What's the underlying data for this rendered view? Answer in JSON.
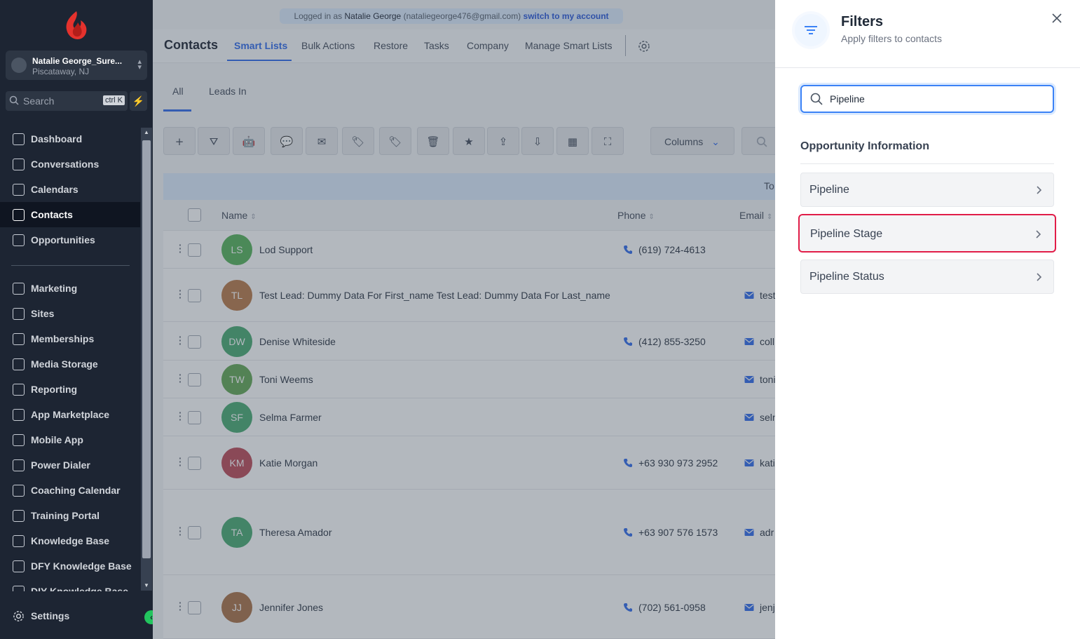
{
  "sidebar": {
    "account": {
      "name": "Natalie George_Sure...",
      "location": "Piscataway, NJ"
    },
    "search": {
      "placeholder": "Search",
      "shortcut": "ctrl K"
    },
    "items": [
      {
        "label": "Dashboard",
        "icon": "dashboard-icon"
      },
      {
        "label": "Conversations",
        "icon": "chat-icon"
      },
      {
        "label": "Calendars",
        "icon": "calendar-icon"
      },
      {
        "label": "Contacts",
        "icon": "contacts-icon",
        "active": true
      },
      {
        "label": "Opportunities",
        "icon": "opportunities-icon"
      },
      {
        "label": "Marketing",
        "icon": "megaphone-icon"
      },
      {
        "label": "Sites",
        "icon": "sites-icon"
      },
      {
        "label": "Memberships",
        "icon": "award-icon"
      },
      {
        "label": "Media Storage",
        "icon": "image-icon"
      },
      {
        "label": "Reporting",
        "icon": "trend-icon"
      },
      {
        "label": "App Marketplace",
        "icon": "grid-icon"
      },
      {
        "label": "Mobile App",
        "icon": "phone-device-icon"
      },
      {
        "label": "Power Dialer",
        "icon": "dialer-icon"
      },
      {
        "label": "Coaching Calendar",
        "icon": "calendar-grid-icon"
      },
      {
        "label": "Training Portal",
        "icon": "flame-icon"
      },
      {
        "label": "Knowledge Base",
        "icon": "lightbulb-icon"
      },
      {
        "label": "DFY Knowledge Base",
        "icon": "users-icon"
      },
      {
        "label": "DIY Knowledge Base",
        "icon": "book-icon"
      }
    ],
    "settings": {
      "label": "Settings",
      "icon": "gear-icon"
    }
  },
  "banner": {
    "prefix": "Logged in as",
    "user": "Natalie George",
    "email": "(nataliegeorge476@gmail.com)",
    "link": "switch to my account"
  },
  "topnav": {
    "title": "Contacts",
    "tabs": [
      "Smart Lists",
      "Bulk Actions",
      "Restore",
      "Tasks",
      "Company",
      "Manage Smart Lists"
    ],
    "active_tab": "Smart Lists"
  },
  "subtabs": [
    "All",
    "Leads In"
  ],
  "toolbar": {
    "icons": [
      "add-icon",
      "filter-icon",
      "robot-icon",
      "message-icon",
      "mail-icon",
      "tag-add-icon",
      "tag-remove-icon",
      "trash-icon",
      "star-icon",
      "export-icon",
      "import-icon",
      "company-icon",
      "merge-icon"
    ],
    "columns_label": "Columns"
  },
  "table": {
    "total_label": "To",
    "headers": {
      "name": "Name",
      "phone": "Phone",
      "email": "Email"
    },
    "rows": [
      {
        "initials": "LS",
        "name": "Lod Support",
        "phone": "(619) 724-4613",
        "email": "",
        "color": "#4caf50"
      },
      {
        "initials": "TL",
        "name": "Test Lead: Dummy Data For First_name Test Lead: Dummy Data For Last_name",
        "phone": "",
        "email": "test",
        "color": "#b5723f"
      },
      {
        "initials": "DW",
        "name": "Denise Whiteside",
        "phone": "(412) 855-3250",
        "email": "coll",
        "color": "#3fa56a"
      },
      {
        "initials": "TW",
        "name": "Toni Weems",
        "phone": "",
        "email": "toni",
        "color": "#5aa24a"
      },
      {
        "initials": "SF",
        "name": "Selma Farmer",
        "phone": "",
        "email": "seln",
        "color": "#3fa56a"
      },
      {
        "initials": "KM",
        "name": "Katie Morgan",
        "phone": "+63 930 973 2952",
        "email": "kati",
        "color": "#b8404f"
      },
      {
        "initials": "TA",
        "name": "Theresa Amador",
        "phone": "+63 907 576 1573",
        "email": "adr",
        "color": "#3fa56a"
      },
      {
        "initials": "JJ",
        "name": "Jennifer Jones",
        "phone": "(702) 561-0958",
        "email": "jenj",
        "color": "#a6693d"
      }
    ]
  },
  "filters_panel": {
    "title": "Filters",
    "subtitle": "Apply filters to contacts",
    "search_value": "Pipeline",
    "section": "Opportunity Information",
    "options": [
      "Pipeline",
      "Pipeline Stage",
      "Pipeline Status"
    ],
    "highlighted": "Pipeline Stage"
  }
}
